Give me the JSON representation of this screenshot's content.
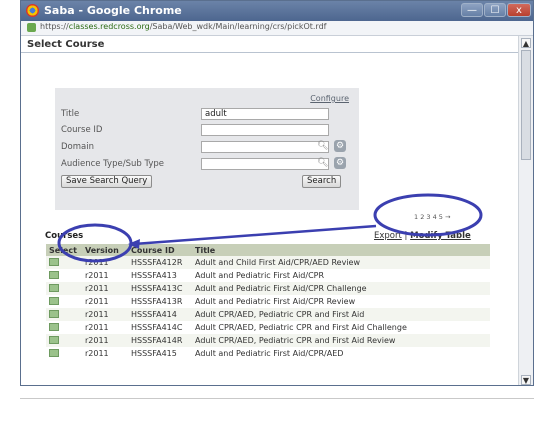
{
  "window": {
    "title": "Saba - Google Chrome",
    "minimize_label": "—",
    "maximize_label": "☐",
    "close_label": "x"
  },
  "address_bar": {
    "url_prefix": "https://",
    "url_host": "classes.redcross.org",
    "url_path": "/Saba/Web_wdk/Main/learning/crs/pickOt.rdf"
  },
  "page": {
    "heading": "Select Course",
    "configure_link": "Configure"
  },
  "search_form": {
    "title_label": "Title",
    "title_value": "adult",
    "course_id_label": "Course ID",
    "course_id_value": "",
    "domain_label": "Domain",
    "domain_value": "",
    "audience_label": "Audience Type/Sub Type",
    "audience_value": "",
    "save_button": "Save Search Query",
    "search_button": "Search"
  },
  "results": {
    "section_label": "Courses",
    "pager": "1 2 3 4 5 →",
    "export_link": "Export",
    "separator": "|",
    "modify_table_link": "Modify Table",
    "columns": [
      "Select",
      "Version",
      "Course ID",
      "Title"
    ],
    "rows": [
      {
        "version": "r2011",
        "course_id": "HSSSFA412R",
        "title": "Adult and Child First Aid/CPR/AED Review"
      },
      {
        "version": "r2011",
        "course_id": "HSSSFA413",
        "title": "Adult and Pediatric First Aid/CPR"
      },
      {
        "version": "r2011",
        "course_id": "HSSSFA413C",
        "title": "Adult and Pediatric First Aid/CPR Challenge"
      },
      {
        "version": "r2011",
        "course_id": "HSSSFA413R",
        "title": "Adult and Pediatric First Aid/CPR Review"
      },
      {
        "version": "r2011",
        "course_id": "HSSSFA414",
        "title": "Adult CPR/AED, Pediatric CPR and First Aid"
      },
      {
        "version": "r2011",
        "course_id": "HSSSFA414C",
        "title": "Adult CPR/AED, Pediatric CPR and First Aid Challenge"
      },
      {
        "version": "r2011",
        "course_id": "HSSSFA414R",
        "title": "Adult CPR/AED, Pediatric CPR and First Aid Review"
      },
      {
        "version": "r2011",
        "course_id": "HSSSFA415",
        "title": "Adult and Pediatric First Aid/CPR/AED"
      }
    ]
  },
  "annotation_color": "#3b3fb0",
  "colors": {
    "titlebar": "#4d668f",
    "table_header": "#c7cfb8",
    "search_panel": "#e6e7ea"
  }
}
